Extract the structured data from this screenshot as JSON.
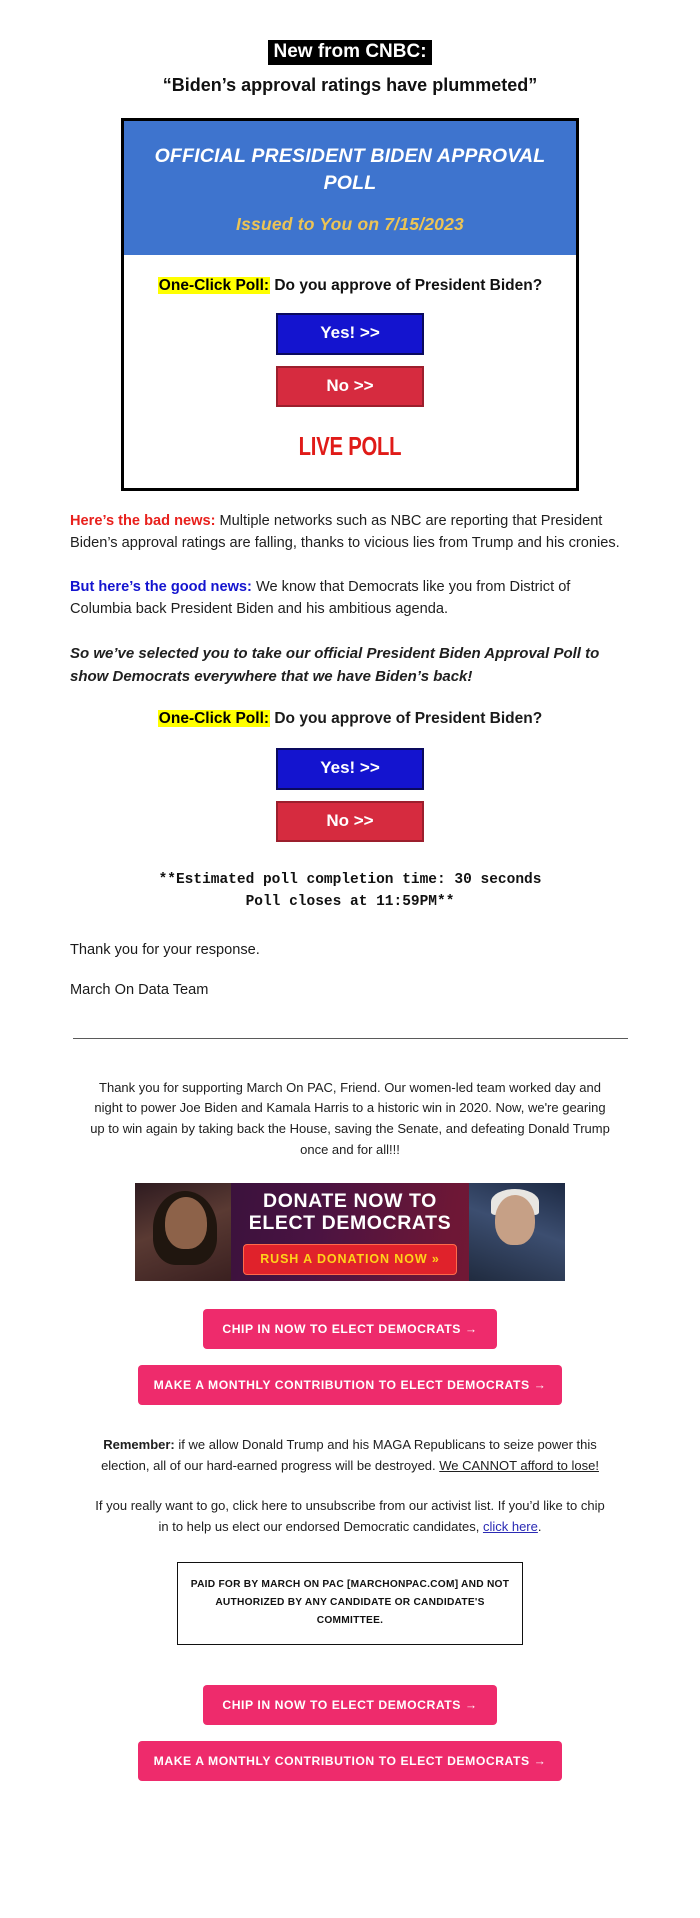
{
  "header": {
    "badge": "New from CNBC:",
    "quote": "“Biden’s approval ratings have plummeted”"
  },
  "poll_card": {
    "title": "OFFICIAL PRESIDENT BIDEN APPROVAL POLL",
    "issued": "Issued to You on 7/15/2023",
    "oneclick_label": "One-Click Poll:",
    "oneclick_question": " Do you approve of President Biden?",
    "yes_button": "Yes! >>",
    "no_button": "No >>",
    "live_poll": "LIVE POLL",
    "colors": {
      "header_blue": "#3e74ce",
      "issued_gold": "#ecc455",
      "yes_blue": "#1414cf",
      "no_red": "#d62b3f",
      "live_red": "#e01b18",
      "highlight_yellow": "#ffff00"
    }
  },
  "body": {
    "para1_lead": "Here’s the bad news:",
    "para1_text": " Multiple networks such as NBC are reporting that President Biden’s approval ratings are falling, thanks to vicious lies from Trump and his cronies.",
    "para2_lead": "But here’s the good news:",
    "para2_text": " We know that Democrats like you from District of Columbia back President Biden and his ambitious agenda.",
    "para3_italic": "So we’ve selected you to take our official President Biden Approval Poll to show Democrats everywhere that we have Biden’s back!",
    "oneclick_label": "One-Click Poll:",
    "oneclick_question": " Do you approve of President Biden?",
    "yes_button": "Yes! >>",
    "no_button": "No >>",
    "mono_line1": "**Estimated poll completion time: 30 seconds",
    "mono_line2": "Poll closes at 11:59PM**",
    "signoff1": "Thank you for your response.",
    "signoff2": "March On Data Team"
  },
  "footer": {
    "intro": "Thank you for supporting March On PAC, Friend. Our women-led team worked day and night to power Joe Biden and Kamala Harris to a historic win in 2020. Now, we're gearing up to win again by taking back the House, saving the Senate, and defeating Donald Trump once and for all!!!",
    "banner": {
      "line1": "DONATE NOW TO",
      "line2": "ELECT DEMOCRATS",
      "cta": "RUSH A DONATION NOW »",
      "colors": {
        "cta_bg": "#e0222b",
        "cta_text": "#ffd21a"
      }
    },
    "cta_chip_in": "CHIP IN NOW TO ELECT DEMOCRATS →",
    "cta_monthly": "MAKE A MONTHLY CONTRIBUTION TO ELECT DEMOCRATS →",
    "cta_color": "#ee2b6c",
    "remember_lead": "Remember:",
    "remember_text": " if we allow Donald Trump and his MAGA Republicans to seize power this election, all of our hard-earned progress will be destroyed. ",
    "remember_underlined": "We CANNOT afford to lose!",
    "unsub_text_1": "If you really want to go, click here to unsubscribe from our activist list. If you’d like to chip in to help us elect our endorsed Democratic candidates, ",
    "unsub_link": "click here",
    "unsub_text_2": ".",
    "paid_for_line1": "PAID FOR BY MARCH ON PAC [MARCHONPAC.COM] AND NOT",
    "paid_for_line2": "AUTHORIZED BY ANY CANDIDATE OR CANDIDATE'S COMMITTEE."
  }
}
